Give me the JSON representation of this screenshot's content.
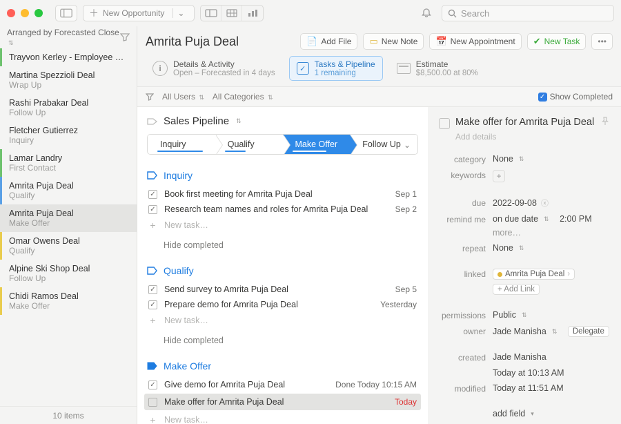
{
  "titlebar": {
    "new_opportunity": "New Opportunity",
    "search_placeholder": "Search"
  },
  "sidebar": {
    "arrange_label": "Arranged by Forecasted Close",
    "footer": "10 items",
    "items": [
      {
        "title": "Trayvon Kerley - Employee Candid...",
        "sub": "",
        "accent": "green"
      },
      {
        "title": "Martina Spezzioli Deal",
        "sub": "Wrap Up",
        "accent": ""
      },
      {
        "title": "Rashi Prabakar Deal",
        "sub": "Follow Up",
        "accent": ""
      },
      {
        "title": "Fletcher Gutierrez",
        "sub": "Inquiry",
        "accent": ""
      },
      {
        "title": "Lamar Landry",
        "sub": "First Contact",
        "accent": "green"
      },
      {
        "title": "Amrita Puja Deal",
        "sub": "Qualify",
        "accent": "blue"
      },
      {
        "title": "Amrita Puja Deal",
        "sub": "Make Offer",
        "accent": "",
        "selected": true
      },
      {
        "title": "Omar Owens Deal",
        "sub": "Qualify",
        "accent": "yellow"
      },
      {
        "title": "Alpine Ski Shop Deal",
        "sub": "Follow Up",
        "accent": ""
      },
      {
        "title": "Chidi Ramos Deal",
        "sub": "Make Offer",
        "accent": "yellow"
      }
    ]
  },
  "main": {
    "title": "Amrita Puja Deal",
    "buttons": {
      "add_file": "Add File",
      "new_note": "New Note",
      "new_appt": "New Appointment",
      "new_task": "New Task"
    },
    "details": {
      "l1": "Details & Activity",
      "l2": "Open – Forecasted in 4 days"
    },
    "tasks": {
      "l1": "Tasks & Pipeline",
      "l2": "1 remaining"
    },
    "estimate": {
      "l1": "Estimate",
      "l2": "$8,500.00 at 80%"
    },
    "filter": {
      "users": "All Users",
      "cats": "All Categories",
      "show_completed": "Show Completed"
    },
    "pipeline_title": "Sales Pipeline",
    "steps": [
      "Inquiry",
      "Qualify",
      "Make Offer",
      "Follow Up"
    ],
    "sections": [
      {
        "name": "Inquiry",
        "filled": false,
        "tasks": [
          {
            "text": "Book first meeting for Amrita Puja Deal",
            "right": "Sep 1",
            "checked": true
          },
          {
            "text": "Research team names and roles for Amrita Puja Deal",
            "right": "Sep 2",
            "checked": true
          }
        ],
        "hide": "Hide completed"
      },
      {
        "name": "Qualify",
        "filled": false,
        "tasks": [
          {
            "text": "Send survey to Amrita Puja Deal",
            "right": "Sep 5",
            "checked": true
          },
          {
            "text": "Prepare demo for Amrita Puja Deal",
            "right": "Yesterday",
            "checked": true
          }
        ],
        "hide": "Hide completed"
      },
      {
        "name": "Make Offer",
        "filled": true,
        "tasks": [
          {
            "text": "Give demo for Amrita Puja Deal",
            "right": "Done Today 10:15 AM",
            "checked": true
          },
          {
            "text": "Make offer for Amrita Puja Deal",
            "right": "Today",
            "checked": false,
            "today": true,
            "selected": true
          }
        ]
      }
    ],
    "new_task": "New task…"
  },
  "inspector": {
    "title": "Make offer for Amrita Puja Deal",
    "add_details": "Add details",
    "fields": {
      "category_lbl": "category",
      "category_val": "None",
      "keywords_lbl": "keywords",
      "due_lbl": "due",
      "due_val": "2022-09-08",
      "remind_lbl": "remind me",
      "remind_val": "on due date",
      "remind_time": "2:00 PM",
      "remind_more": "more…",
      "repeat_lbl": "repeat",
      "repeat_val": "None",
      "linked_lbl": "linked",
      "linked_chip": "Amrita Puja Deal",
      "add_link": "+ Add Link",
      "perm_lbl": "permissions",
      "perm_val": "Public",
      "owner_lbl": "owner",
      "owner_val": "Jade Manisha",
      "delegate": "Delegate",
      "created_lbl": "created",
      "created_val": "Jade Manisha",
      "created_at": "Today at 10:13 AM",
      "modified_lbl": "modified",
      "modified_at": "Today at 11:51 AM",
      "add_field": "add field"
    }
  }
}
